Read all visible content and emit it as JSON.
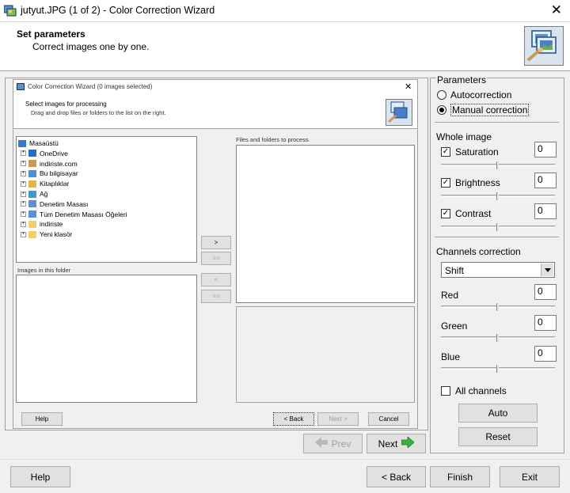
{
  "window": {
    "title": "jutyut.JPG (1 of 2) - Color Correction Wizard",
    "close": "✕"
  },
  "header": {
    "title": "Set parameters",
    "subtitle": "Correct images one by one."
  },
  "inner_window": {
    "title": "Color Correction Wizard (0 images selected)",
    "close": "✕",
    "heading": "Select images for processing",
    "subheading": "Drag and drop files or folders to the list on the right.",
    "tree": [
      {
        "label": "Masaüstü",
        "icon": "desktop-icon",
        "level": 0
      },
      {
        "label": "OneDrive",
        "icon": "cloud-icon",
        "level": 1
      },
      {
        "label": "indiriste.com",
        "icon": "user-icon",
        "level": 1
      },
      {
        "label": "Bu bilgisayar",
        "icon": "computer-icon",
        "level": 1
      },
      {
        "label": "Kitaplıklar",
        "icon": "library-icon",
        "level": 1
      },
      {
        "label": "Ağ",
        "icon": "network-icon",
        "level": 1
      },
      {
        "label": "Denetim Masası",
        "icon": "control-panel-icon",
        "level": 1
      },
      {
        "label": "Tüm Denetim Masası Öğeleri",
        "icon": "control-panel-icon",
        "level": 1
      },
      {
        "label": "indiriste",
        "icon": "folder-icon",
        "level": 1
      },
      {
        "label": "Yeni klasör",
        "icon": "folder-icon",
        "level": 1
      }
    ],
    "images_label": "Images in this folder",
    "files_label": "Files and folders to process",
    "move_buttons": [
      ">",
      ">>",
      "<",
      "<<"
    ],
    "help": "Help",
    "back": "< Back",
    "next": "Next >",
    "cancel": "Cancel"
  },
  "preview_nav": {
    "prev": "Prev",
    "next": "Next"
  },
  "params": {
    "group_label": "Parameters",
    "autocorrection": "Autocorrection",
    "manual": "Manual correction",
    "selected": "manual",
    "whole_image": "Whole image",
    "saturation": {
      "label": "Saturation",
      "value": "0",
      "checked": true
    },
    "brightness": {
      "label": "Brightness",
      "value": "0",
      "checked": true
    },
    "contrast": {
      "label": "Contrast",
      "value": "0",
      "checked": true
    },
    "channels_label": "Channels correction",
    "mode": "Shift",
    "red": {
      "label": "Red",
      "value": "0"
    },
    "green": {
      "label": "Green",
      "value": "0"
    },
    "blue": {
      "label": "Blue",
      "value": "0"
    },
    "all_channels": {
      "label": "All channels",
      "checked": false
    },
    "auto": "Auto",
    "reset": "Reset"
  },
  "footer": {
    "help": "Help",
    "back": "< Back",
    "finish": "Finish",
    "exit": "Exit"
  },
  "colors": {
    "accent": "#0078d7",
    "arrow_green": "#3cb043",
    "disabled": "#a0a0a0"
  }
}
